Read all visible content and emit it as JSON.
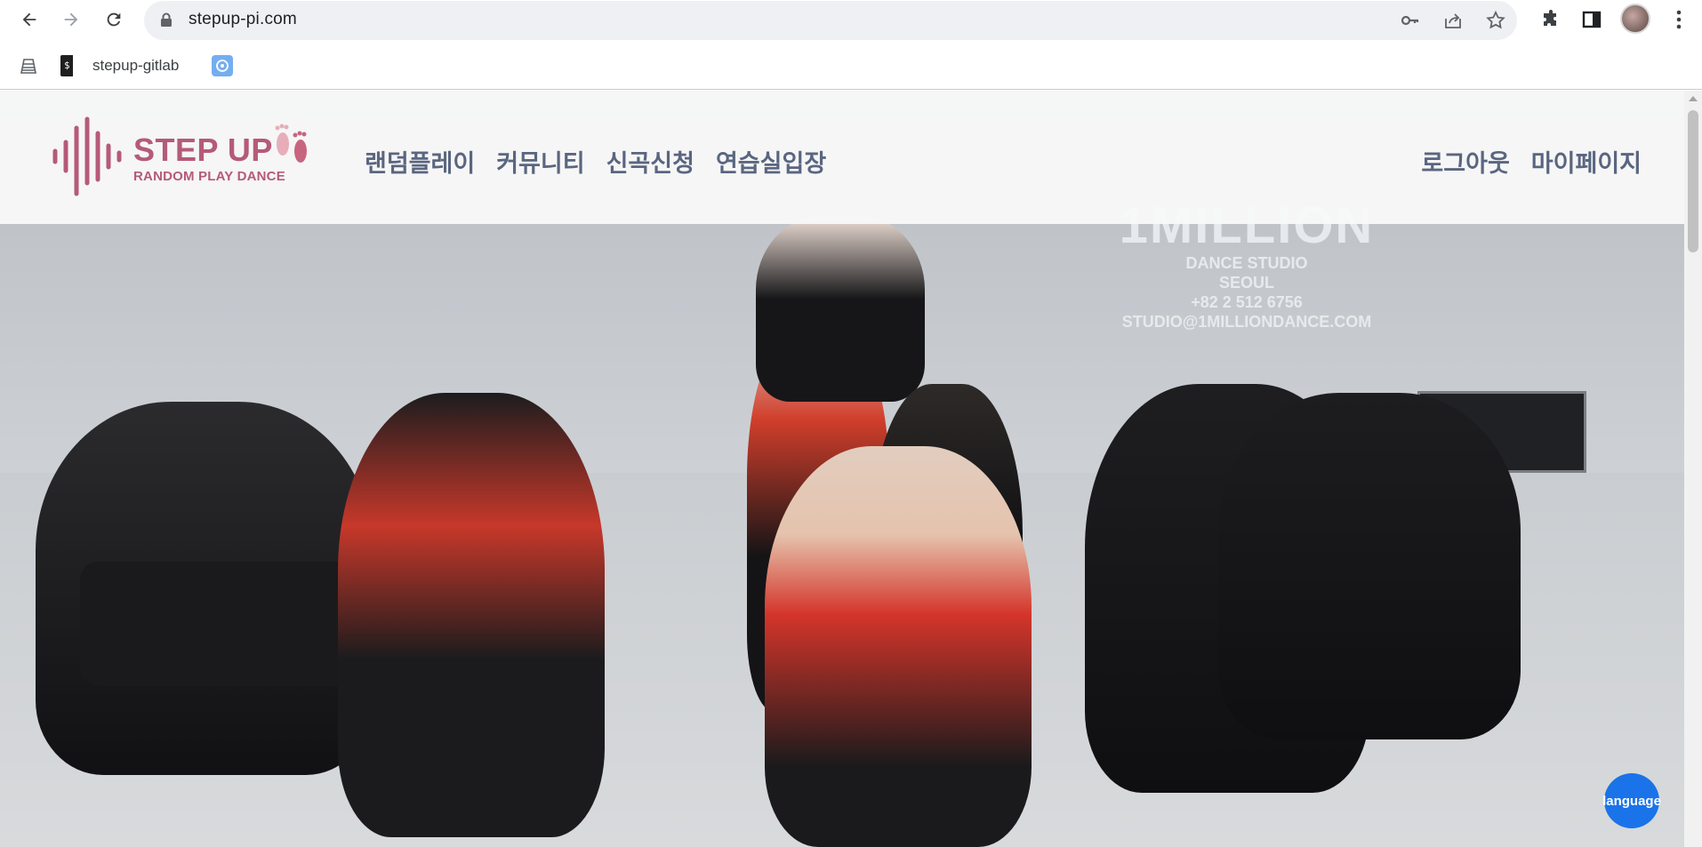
{
  "browser": {
    "url": "stepup-pi.com",
    "icons": {
      "back": "back-arrow-icon",
      "forward": "forward-arrow-icon",
      "reload": "reload-icon",
      "lock": "lock-icon",
      "key": "key-icon",
      "share": "share-icon",
      "star": "star-icon",
      "extensions": "puzzle-icon",
      "side_panel": "side-panel-icon",
      "profile": "avatar",
      "menu": "kebab-menu-icon"
    }
  },
  "bookmarks": [
    {
      "label": "",
      "icon": "stack-icon"
    },
    {
      "label": "stepup-gitlab",
      "icon": "terminal-bookmark-icon"
    },
    {
      "label": "",
      "icon": "openai-icon"
    }
  ],
  "site": {
    "logo": {
      "title": "STEP UP",
      "subtitle": "RANDOM PLAY DANCE",
      "color": "#b55a79"
    },
    "menu": [
      "랜덤플레이",
      "커뮤니티",
      "신곡신청",
      "연습실입장"
    ],
    "account_menu": [
      "로그아웃",
      "마이페이지"
    ],
    "hero": {
      "wall_text": {
        "brand": "1MILLION",
        "line1": "DANCE STUDIO",
        "line2": "SEOUL",
        "line3": "+82 2 512 6756",
        "line4": "STUDIO@1MILLIONDANCE.COM"
      }
    },
    "language_button": "language"
  }
}
